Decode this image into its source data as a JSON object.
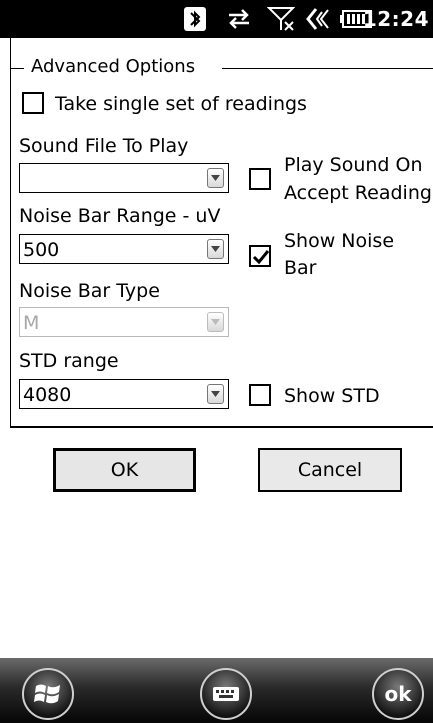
{
  "statusbar": {
    "time": "12:24",
    "icons": [
      "bluetooth-icon",
      "data-sync-icon",
      "signal-off-icon",
      "volume-icon",
      "battery-icon"
    ]
  },
  "group": {
    "title": "Advanced Options"
  },
  "options": {
    "single_readings": {
      "label": "Take single set of readings",
      "checked": false
    },
    "sound_file_label": "Sound File To Play",
    "sound_file_value": "",
    "play_sound_label_1": "Play Sound On",
    "play_sound_label_2": "Accept Reading",
    "play_sound_checked": false,
    "noise_range_label": "Noise Bar Range - uV",
    "noise_range_value": "500",
    "show_noise_label_1": "Show Noise",
    "show_noise_label_2": "Bar",
    "show_noise_checked": true,
    "noise_type_label": "Noise Bar Type",
    "noise_type_value": "M",
    "std_range_label": "STD range",
    "std_range_value": "4080",
    "show_std_label": "Show STD",
    "show_std_checked": false
  },
  "buttons": {
    "ok": "OK",
    "cancel": "Cancel"
  },
  "taskbar": {
    "start_icon": "windows-flag-icon",
    "keyboard_icon": "keyboard-icon",
    "ok_label": "ok"
  },
  "colors": {
    "status_bg": "#000000",
    "button_bg": "#e9e9e9",
    "disabled_text": "#a8a8a8"
  }
}
